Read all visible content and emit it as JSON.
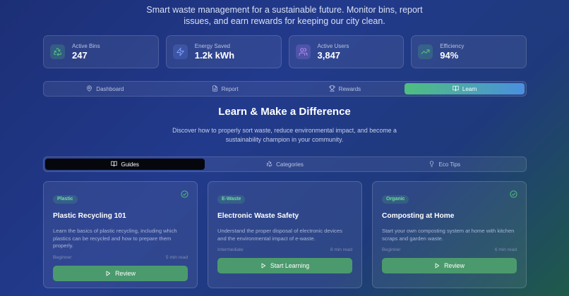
{
  "hero": {
    "subtitle_line1": "Smart waste management for a sustainable future. Monitor bins, report",
    "subtitle_line2": "issues, and earn rewards for keeping our city clean."
  },
  "stats": [
    {
      "label": "Active Bins",
      "value": "247",
      "icon": "recycle-icon",
      "color": "#4fbf7e"
    },
    {
      "label": "Energy Saved",
      "value": "1.2k kWh",
      "icon": "lightning-icon",
      "color": "#6d8cf0"
    },
    {
      "label": "Active Users",
      "value": "3,847",
      "icon": "users-icon",
      "color": "#a77be8"
    },
    {
      "label": "Efficiency",
      "value": "94%",
      "icon": "trending-up-icon",
      "color": "#4fbf7e"
    }
  ],
  "tabs": [
    {
      "label": "Dashboard",
      "icon": "map-pin-icon",
      "active": false
    },
    {
      "label": "Report",
      "icon": "document-icon",
      "active": false
    },
    {
      "label": "Rewards",
      "icon": "trophy-icon",
      "active": false
    },
    {
      "label": "Learn",
      "icon": "book-icon",
      "active": true
    }
  ],
  "learn": {
    "title": "Learn & Make a Difference",
    "desc_line1": "Discover how to properly sort waste, reduce environmental impact, and become a",
    "desc_line2": "sustainability champion in your community."
  },
  "subtabs": [
    {
      "label": "Guides",
      "icon": "book-icon",
      "active": true
    },
    {
      "label": "Categories",
      "icon": "recycle-icon",
      "active": false
    },
    {
      "label": "Eco Tips",
      "icon": "lightbulb-icon",
      "active": false
    }
  ],
  "guides": [
    {
      "badge": "Plastic",
      "completed": true,
      "title": "Plastic Recycling 101",
      "desc": "Learn the basics of plastic recycling, including which plastics can be recycled and how to prepare them properly.",
      "level": "Beginner",
      "duration": "5 min read",
      "button": "Review"
    },
    {
      "badge": "E-Waste",
      "completed": false,
      "title": "Electronic Waste Safety",
      "desc": "Understand the proper disposal of electronic devices and the environmental impact of e-waste.",
      "level": "Intermediate",
      "duration": "8 min read",
      "button": "Start Learning"
    },
    {
      "badge": "Organic",
      "completed": true,
      "title": "Composting at Home",
      "desc": "Start your own composting system at home with kitchen scraps and garden waste.",
      "level": "Beginner",
      "duration": "6 min read",
      "button": "Review"
    }
  ]
}
